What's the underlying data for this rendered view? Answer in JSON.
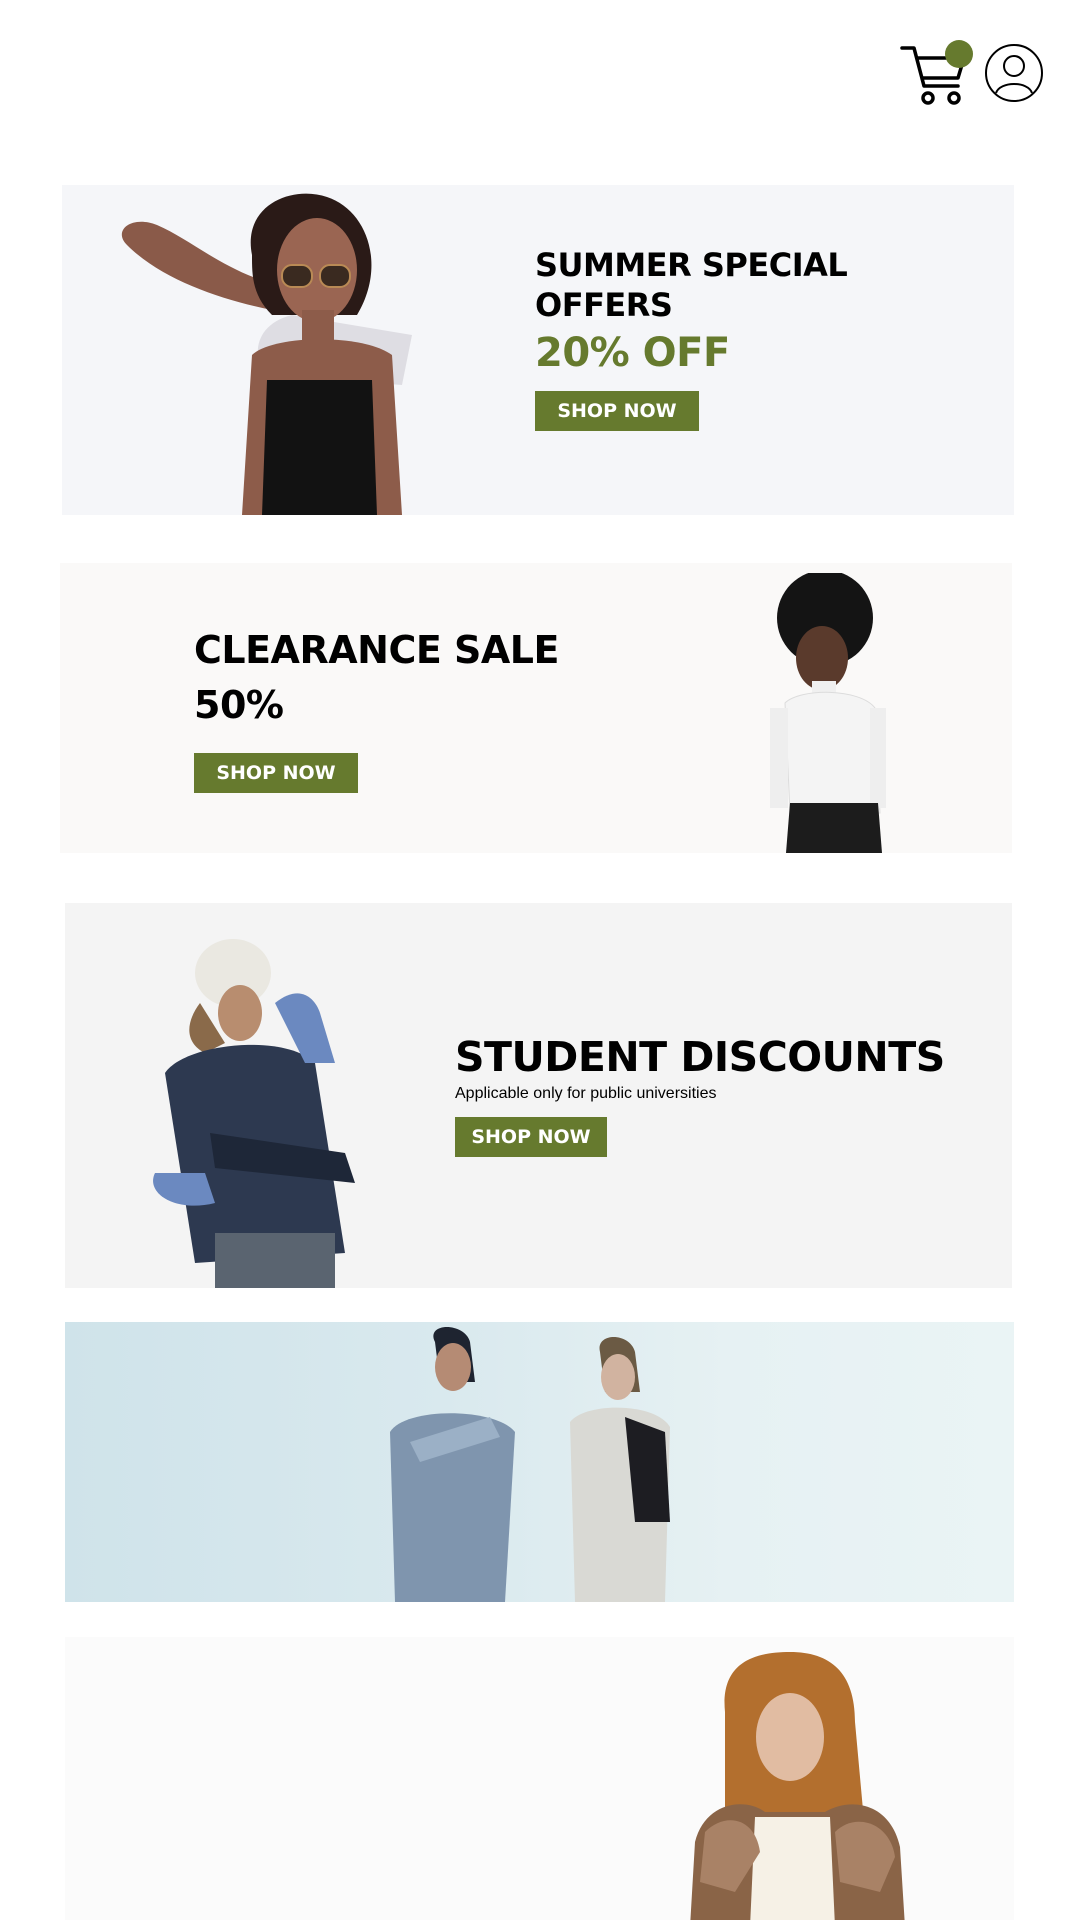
{
  "header": {
    "cart_icon": "shopping-cart-icon",
    "cart_badge_color": "#667a2e",
    "account_icon": "user-account-icon"
  },
  "colors": {
    "accent": "#667a2e",
    "button_text": "#ffffff"
  },
  "banners": [
    {
      "title": "SUMMER SPECIAL OFFERS",
      "offer": "20% OFF",
      "button": "SHOP NOW"
    },
    {
      "title": "CLEARANCE SALE",
      "offer": "50%",
      "button": "SHOP NOW"
    },
    {
      "title": "STUDENT DISCOUNTS",
      "subtitle": "Applicable only for public universities",
      "button": "SHOP NOW"
    }
  ]
}
